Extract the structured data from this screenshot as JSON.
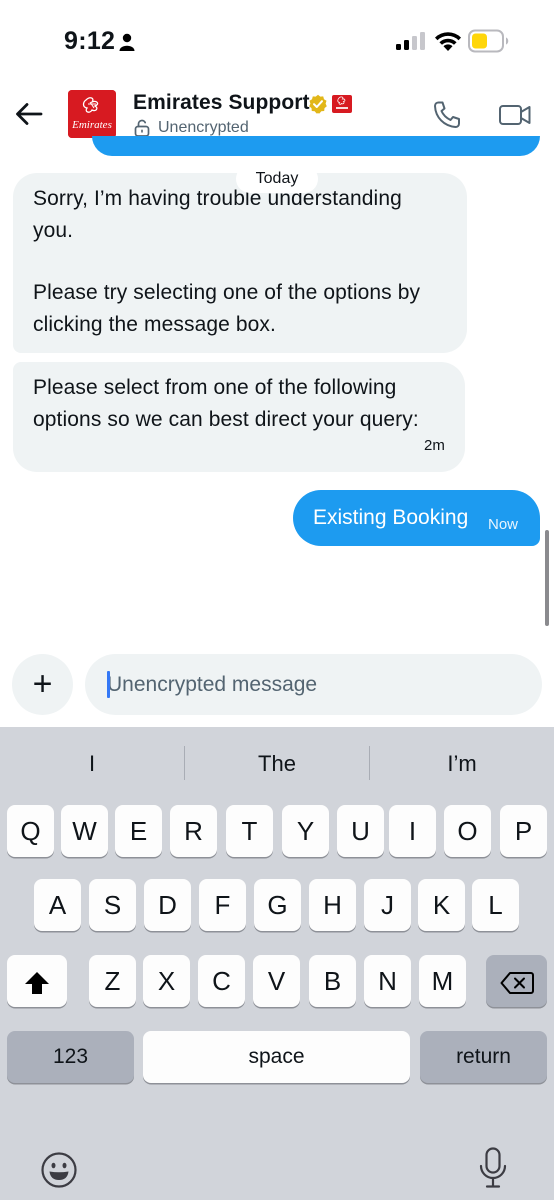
{
  "status_bar": {
    "time": "9:12"
  },
  "header": {
    "contact_name": "Emirates Support",
    "encryption_status": "Unencrypted",
    "avatar_text": "Emirates",
    "brand_color": "#d71a21"
  },
  "chat": {
    "date_separator": "Today",
    "messages": [
      {
        "direction": "incoming",
        "paragraphs": [
          "Sorry, I’m having trouble understanding you.",
          "Please try selecting one of the options by clicking the message box."
        ]
      },
      {
        "direction": "incoming",
        "text": "Please select from one of the following options so we can best direct your query:",
        "time": "2m"
      },
      {
        "direction": "outgoing",
        "text": "Existing Booking",
        "time": "Now"
      }
    ]
  },
  "composer": {
    "placeholder": "Unencrypted message",
    "value": ""
  },
  "keyboard": {
    "suggestions": [
      "I",
      "The",
      "I’m"
    ],
    "row1": [
      "Q",
      "W",
      "E",
      "R",
      "T",
      "Y",
      "U",
      "I",
      "O",
      "P"
    ],
    "row2": [
      "A",
      "S",
      "D",
      "F",
      "G",
      "H",
      "J",
      "K",
      "L"
    ],
    "row3": [
      "Z",
      "X",
      "C",
      "V",
      "B",
      "N",
      "M"
    ],
    "numbers_label": "123",
    "space_label": "space",
    "return_label": "return"
  },
  "colors": {
    "accent": "#1d9bf0",
    "incoming_bubble": "#eff3f4",
    "keyboard_bg": "#d1d4da",
    "battery": "#ffd60a"
  }
}
